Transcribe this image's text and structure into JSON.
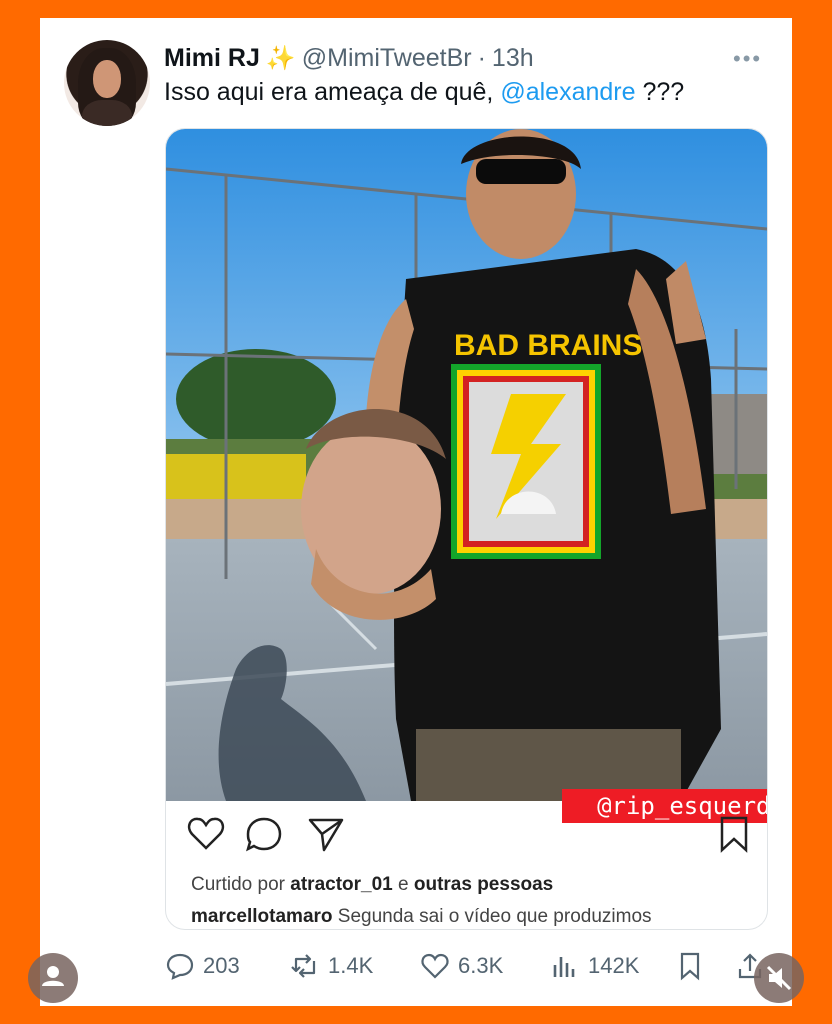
{
  "tweet": {
    "author_name": "Mimi RJ",
    "author_emoji": "✨",
    "handle": "@MimiTweetBr",
    "separator": "·",
    "time": "13h",
    "text_before": "Isso aqui era ameaça de quê, ",
    "mention": "@alexandre",
    "text_after": " ???",
    "more_icon": "more-icon"
  },
  "embed": {
    "shirt_text": "BAD BRAINS",
    "overlay_tag": "@rip_esquerda",
    "liked_prefix": "Curtido por ",
    "liked_user": "atractor_01",
    "liked_middle": " e ",
    "liked_rest": "outras pessoas",
    "caption_user": "marcellotamaro",
    "caption_text": " Segunda sai o vídeo que produzimos"
  },
  "metrics": {
    "replies": "203",
    "retweets": "1.4K",
    "likes": "6.3K",
    "views": "142K"
  },
  "colors": {
    "frame": "#ff6a00",
    "link": "#1d9bf0",
    "tag_bg": "#ee1c25",
    "muted": "#536471"
  }
}
